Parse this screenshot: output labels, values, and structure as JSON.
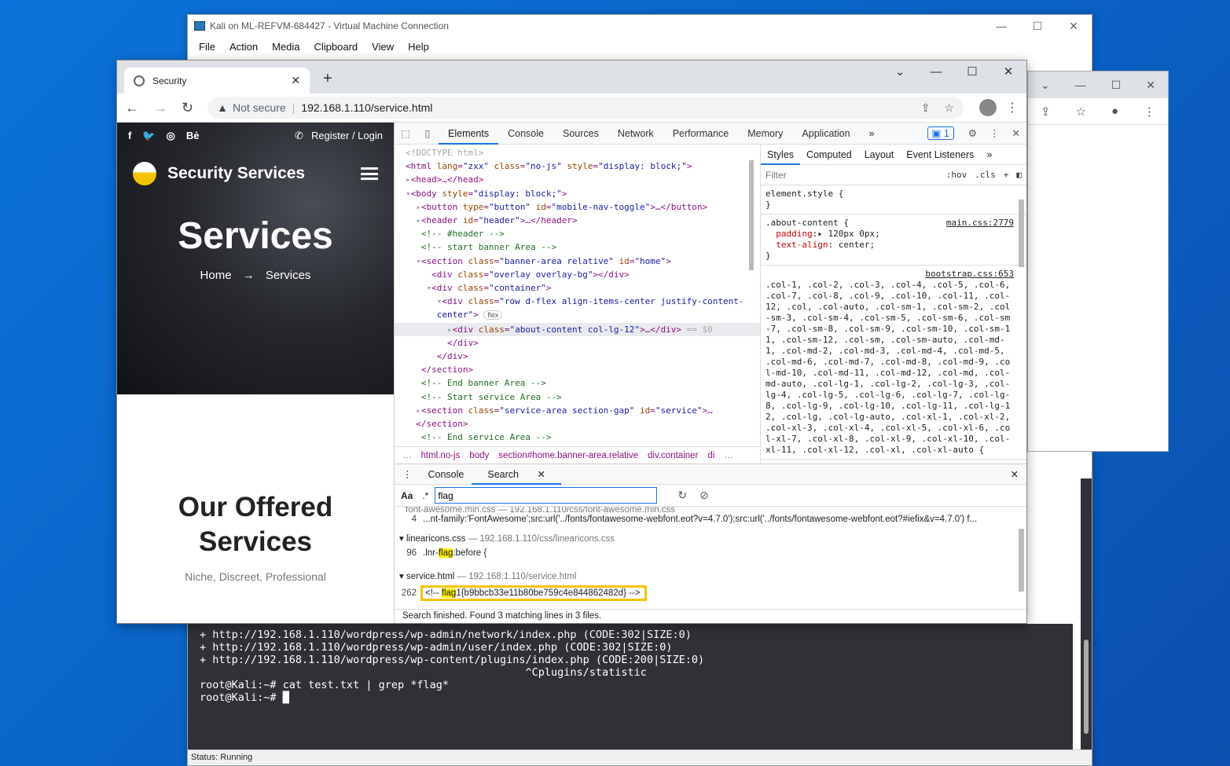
{
  "vm": {
    "title": "Kali on ML-REFVM-684427 - Virtual Machine Connection",
    "menu": [
      "File",
      "Action",
      "Media",
      "Clipboard",
      "View",
      "Help"
    ],
    "status": "Status: Running",
    "terminal": [
      "+ http://192.168.1.110/wordpress/wp-admin/network/index.php (CODE:302|SIZE:0)",
      "",
      "+ http://192.168.1.110/wordpress/wp-admin/user/index.php (CODE:302|SIZE:0)",
      "",
      "+ http://192.168.1.110/wordpress/wp-content/plugins/index.php (CODE:200|SIZE:0)",
      "                                                   ^Cplugins/statistic",
      "root@Kali:~# cat test.txt | grep *flag*",
      "root@Kali:~# █"
    ]
  },
  "browser": {
    "tab_title": "Security",
    "not_secure": "Not secure",
    "url": "192.168.1.110/service.html"
  },
  "site": {
    "top_links": [
      "f",
      "🐦",
      "◎",
      "Bė"
    ],
    "register": "Register / Login",
    "brand": "Security Services",
    "hero_title": "Services",
    "crumb_home": "Home",
    "crumb_arrow": "→",
    "crumb_current": "Services",
    "offered_title": "Our Offered Services",
    "offered_sub": "Niche, Discreet, Professional"
  },
  "devtools": {
    "tabs": [
      "Elements",
      "Console",
      "Sources",
      "Network",
      "Performance",
      "Memory",
      "Application"
    ],
    "issues_count": "1",
    "style_tabs": [
      "Styles",
      "Computed",
      "Layout",
      "Event Listeners"
    ],
    "filter_placeholder": "Filter",
    "hov": ":hov",
    "cls": ".cls",
    "breadcrumbs": [
      "html.no-js",
      "body",
      "section#home.banner-area.relative",
      "div.container",
      "di"
    ],
    "element_style": "element.style {",
    "rule1_selector": ".about-content {",
    "rule1_source": "main.css:2779",
    "rule1_prop1": "padding",
    "rule1_val1": "▸ 120px 0px;",
    "rule1_prop2": "text-align",
    "rule1_val2": " center;",
    "rule2_source": "bootstrap.css:653",
    "rule2_selectors": ".col-1, .col-2, .col-3, .col-4, .col-5, .col-6, .col-7, .col-8, .col-9, .col-10, .col-11, .col-12, .col, .col-auto, .col-sm-1, .col-sm-2, .col-sm-3, .col-sm-4, .col-sm-5, .col-sm-6, .col-sm-7, .col-sm-8, .col-sm-9, .col-sm-10, .col-sm-11, .col-sm-12, .col-sm, .col-sm-auto, .col-md-1, .col-md-2, .col-md-3, .col-md-4, .col-md-5, .col-md-6, .col-md-7, .col-md-8, .col-md-9, .col-md-10, .col-md-11, .col-md-12, .col-md, .col-md-auto, .col-lg-1, .col-lg-2, .col-lg-3, .col-lg-4, .col-lg-5, .col-lg-6, .col-lg-7, .col-lg-8, .col-lg-9, .col-lg-10, .col-lg-11, .col-lg-12, .col-lg, .col-lg-auto, .col-xl-1, .col-xl-2, .col-xl-3, .col-xl-4, .col-xl-5, .col-xl-6, .col-xl-7, .col-xl-8, .col-xl-9, .col-xl-10, .col-xl-11, .col-xl-12, .col-xl, .col-xl-auto {",
    "drawer_tabs": [
      "Console",
      "Search"
    ],
    "search_value": "flag",
    "search_aa": "Aa",
    "search_regex": ".*",
    "results": {
      "partial_header": "font-awesome.min.css — 192.168.1.110/css/font-awesome.min.css",
      "fa_line_num": "4",
      "fa_line": "...nt-family:'FontAwesome';src:url('../fonts/fontawesome-webfont.eot?v=4.7.0');src:url('../fonts/fontawesome-webfont.eot?#iefix&v=4.7.0') f...",
      "f1_name": "linearicons.css",
      "f1_path": "192.168.1.110/css/linearicons.css",
      "f1_num": "96",
      "f1_pre": ".lnr-",
      "f1_hit": "flag",
      "f1_post": ":before {",
      "f2_name": "service.html",
      "f2_path": "192.168.1.110/service.html",
      "f2_num": "262",
      "f2_pre": "<!-- ",
      "f2_hit": "flag",
      "f2_post": "1{b9bbcb33e11b80be759c4e844862482d} -->",
      "status": "Search finished.  Found 3 matching lines in 3 files."
    }
  }
}
